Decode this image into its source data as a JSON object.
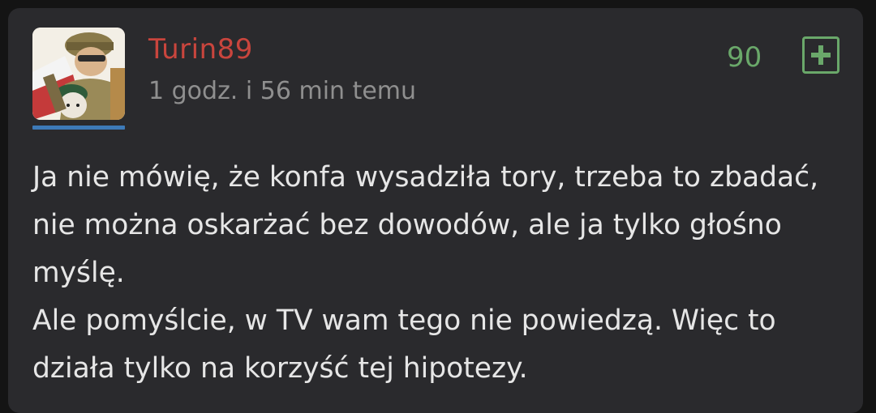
{
  "comment": {
    "author": "Turin89",
    "timestamp": "1 godz. i 56 min temu",
    "score": "90",
    "upvote_icon": "plus-box-icon",
    "paragraphs": [
      "Ja nie mówię, że konfa wysadziła tory, trzeba to zbadać, nie można oskarżać bez dowodów, ale ja tylko głośno myślę.",
      "Ale pomyślcie, w TV wam tego nie powiedzą. Więc to działa tylko na korzyść tej hipotezy."
    ]
  },
  "colors": {
    "background": "#141414",
    "card": "#2a2a2d",
    "author": "#c9453d",
    "timestamp": "#8f8f8f",
    "score": "#6aa86a",
    "text": "#e6e6e6",
    "avatar_underline": "#3d7ab8"
  }
}
